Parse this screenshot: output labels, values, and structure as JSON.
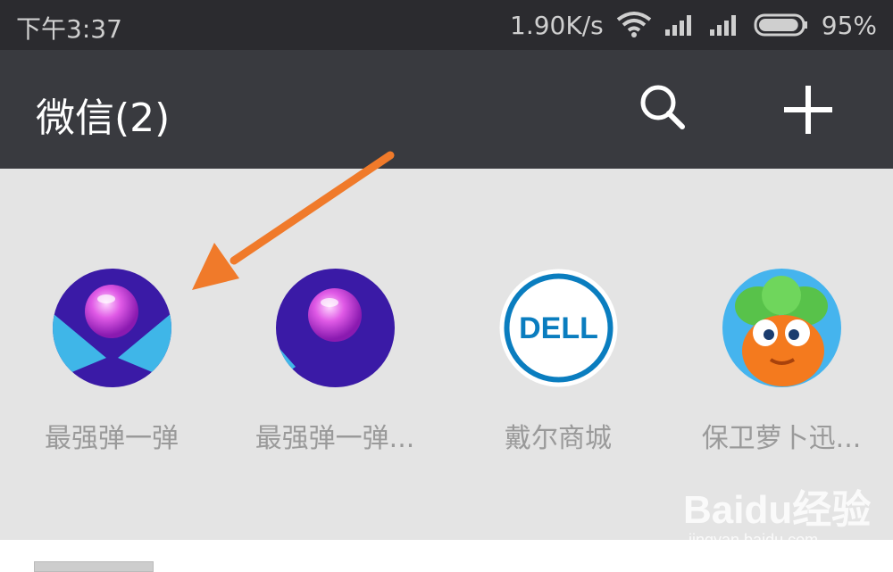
{
  "status_bar": {
    "time": "下午3:37",
    "network_speed": "1.90K/s",
    "battery_percent": "95%",
    "battery_level": 0.95,
    "icons": [
      "wifi-icon",
      "signal-icon",
      "signal-icon",
      "battery-icon"
    ]
  },
  "header": {
    "title": "微信(2)",
    "icons": [
      "search-icon",
      "add-icon"
    ]
  },
  "mini_programs": [
    {
      "label": "最强弹一弹",
      "icon": "bouncing-ball-icon"
    },
    {
      "label": "最强弹一弹...",
      "icon": "bouncing-ball-icon"
    },
    {
      "label": "戴尔商城",
      "icon": "dell-logo-icon",
      "logo_text": "DELL"
    },
    {
      "label": "保卫萝卜迅...",
      "icon": "carrot-character-icon"
    }
  ],
  "annotation": {
    "icon": "arrow-icon",
    "color": "#f07a2a"
  },
  "watermark": {
    "brand": "Baidu经验",
    "url": "jingyan.baidu.com"
  },
  "colors": {
    "status_bar_bg": "#2b2b2f",
    "title_bar_bg": "#393a3f",
    "content_bg": "#e4e4e4",
    "label_text": "#9a9a9a"
  }
}
